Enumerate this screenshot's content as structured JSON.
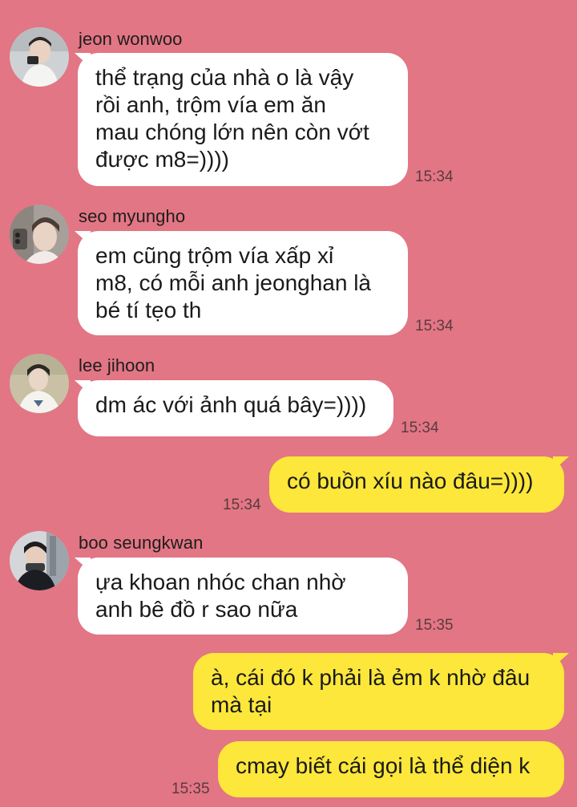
{
  "messages": [
    {
      "sender": "jeon wonwoo",
      "avatar_icon": "avatar-wonwoo",
      "lines": [
        "thể trạng của nhà o là vậy",
        "rồi anh, trộm vía em ăn",
        "mau chóng lớn nên còn vớt",
        "được m8=))))"
      ],
      "time": "15:34"
    },
    {
      "sender": "seo myungho",
      "avatar_icon": "avatar-myungho",
      "lines": [
        "em cũng trộm vía xấp xỉ",
        "m8, có mỗi anh jeonghan là",
        "bé tí tẹo th"
      ],
      "time": "15:34"
    },
    {
      "sender": "lee jihoon",
      "avatar_icon": "avatar-jihoon",
      "lines": [
        "dm ác với ảnh quá bây=))))"
      ],
      "time": "15:34"
    },
    {
      "outgoing": true,
      "lines": [
        "có buồn xíu nào đâu=))))"
      ],
      "time": "15:34"
    },
    {
      "sender": "boo seungkwan",
      "avatar_icon": "avatar-seungkwan",
      "lines": [
        "ựa khoan nhóc chan nhờ",
        "anh bê đồ r sao nữa"
      ],
      "time": "15:35"
    },
    {
      "outgoing": true,
      "lines": [
        "à, cái đó k phải là ẻm k nhờ đâu",
        "mà tại"
      ]
    },
    {
      "outgoing": true,
      "lines": [
        "cmay biết cái gọi là thể diện k"
      ],
      "time": "15:35"
    }
  ],
  "colors": {
    "background": "#e27684",
    "incoming_bubble": "#ffffff",
    "outgoing_bubble": "#fde73a"
  }
}
